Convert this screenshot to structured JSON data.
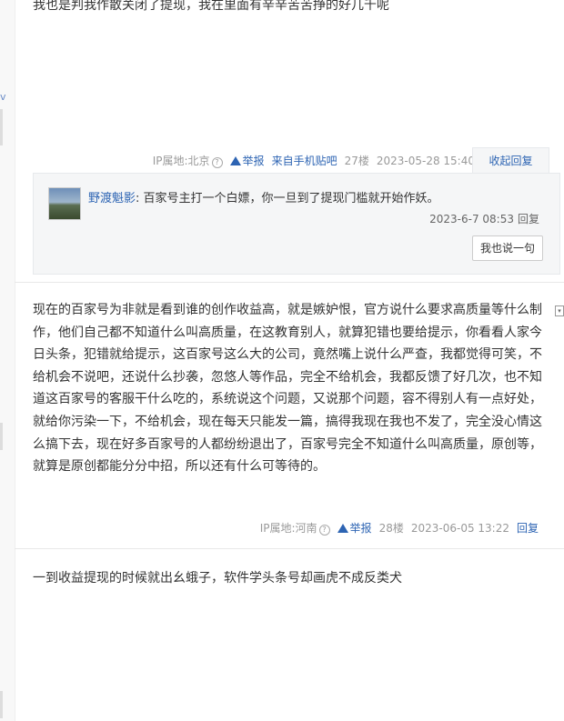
{
  "left_strip": {
    "partial_label": "v"
  },
  "post_top": {
    "content": "我也是判我作散关闭了提现，我在里面有辛辛苦苦挣的好几千呢",
    "ip_label": "IP属地:北京",
    "help_icon": "?",
    "report_label": "举报",
    "source_label": "来自手机贴吧",
    "floor": "27楼",
    "time": "2023-05-28 15:40",
    "fold_reply_label": "收起回复"
  },
  "reply": {
    "avatar": "avatar-icon",
    "name": "野渡魁影",
    "separator": ":",
    "text": " 百家号主打一个白嫖，你一旦到了提现门槛就开始作妖。",
    "time": "2023-6-7 08:53",
    "reply_label": "回复",
    "say_button": "我也说一句"
  },
  "post_28": {
    "content": "现在的百家号为非就是看到谁的创作收益高，就是嫉妒恨，官方说什么要求高质量等什么制作，他们自己都不知道什么叫高质量，在这教育别人，就算犯错也要给提示，你看看人家今日头条，犯错就给提示，这百家号这么大的公司，竟然嘴上说什么严查，我都觉得可笑，不给机会不说吧，还说什么抄袭，忽悠人等作品，完全不给机会，我都反馈了好几次，也不知道这百家号的客服干什么吃的，系统说这个问题，又说那个问题，容不得别人有一点好处，就给你污染一下，不给机会，现在每天只能发一篇，搞得我现在我也不发了，完全没心情这么搞下去，现在好多百家号的人都纷纷退出了，百家号完全不知道什么叫高质量，原创等，就算是原创都能分分中招，所以还有什么可等待的。",
    "ip_label": "IP属地:河南",
    "help_icon": "?",
    "report_label": "举报",
    "floor": "28楼",
    "time": "2023-06-05 13:22",
    "reply_label": "回复"
  },
  "post_29": {
    "content": "一到收益提现的时候就出幺蛾子，软件学头条号却画虎不成反类犬"
  },
  "colors": {
    "link": "#2d64b3",
    "meta": "#999999",
    "reply_bg": "#f5f6f7"
  }
}
